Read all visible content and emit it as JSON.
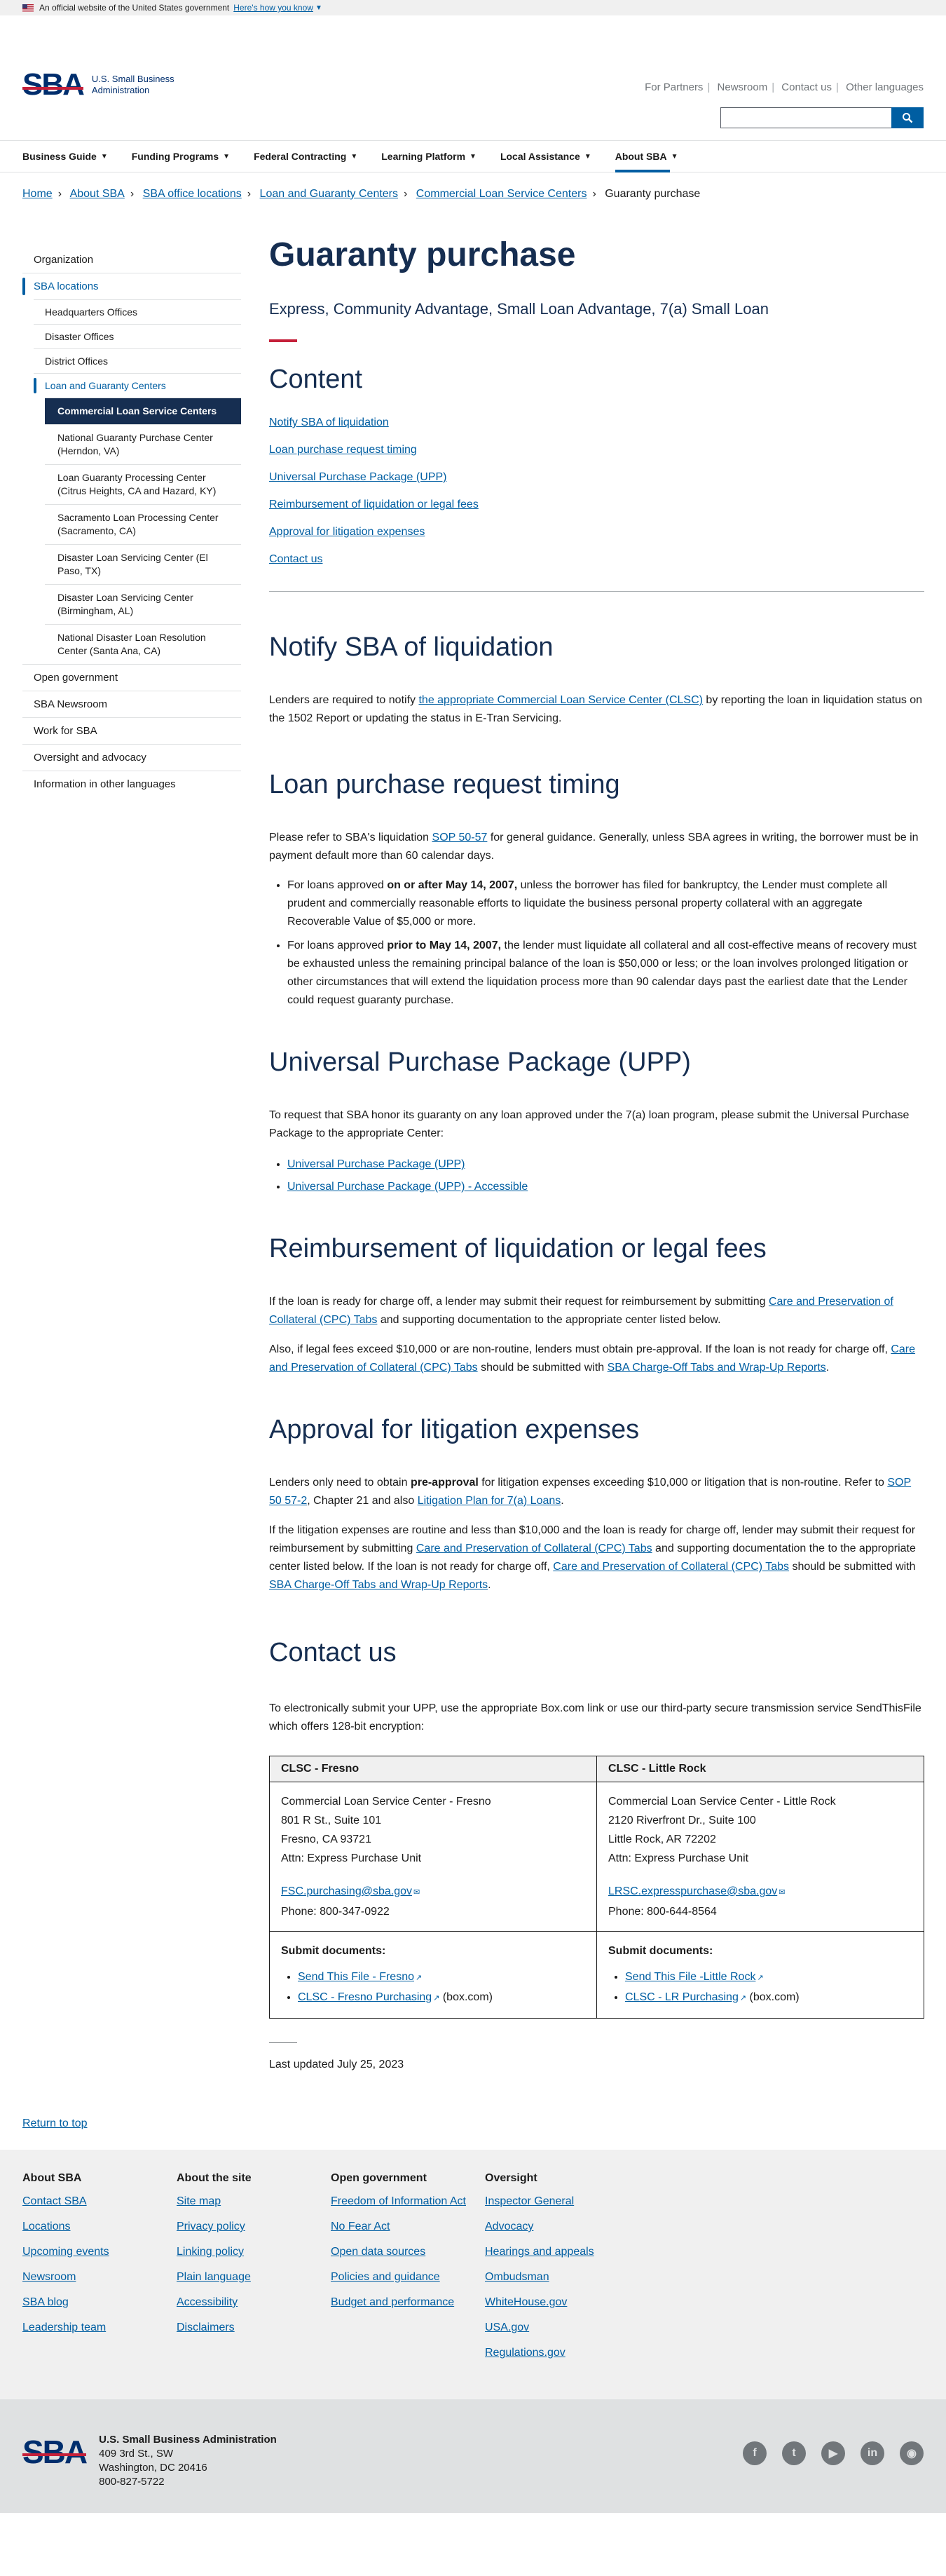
{
  "gov_banner": {
    "text": "An official website of the United States government",
    "link": "Here's how you know"
  },
  "header": {
    "logo_mark": "SBA",
    "logo_line1": "U.S. Small Business",
    "logo_line2": "Administration",
    "util_links": [
      "For Partners",
      "Newsroom",
      "Contact us",
      "Other languages"
    ],
    "search_placeholder": ""
  },
  "nav": [
    "Business Guide",
    "Funding Programs",
    "Federal Contracting",
    "Learning Platform",
    "Local Assistance",
    "About SBA"
  ],
  "breadcrumb": [
    "Home",
    "About SBA",
    "SBA office locations",
    "Loan and Guaranty Centers",
    "Commercial Loan Service Centers",
    "Guaranty purchase"
  ],
  "sidebar": {
    "items": [
      "Organization",
      "SBA locations"
    ],
    "sub": [
      "Headquarters Offices",
      "Disaster Offices",
      "District Offices",
      "Loan and Guaranty Centers"
    ],
    "sub2": [
      "Commercial Loan Service Centers",
      "National Guaranty Purchase Center (Herndon, VA)",
      "Loan Guaranty Processing Center (Citrus Heights, CA and Hazard, KY)",
      "Sacramento Loan Processing Center (Sacramento, CA)",
      "Disaster Loan Servicing Center (El Paso, TX)",
      "Disaster Loan Servicing Center (Birmingham, AL)",
      "National Disaster Loan Resolution Center (Santa Ana, CA)"
    ],
    "after": [
      "Open government",
      "SBA Newsroom",
      "Work for SBA",
      "Oversight and advocacy",
      "Information in other languages"
    ]
  },
  "page": {
    "title": "Guaranty purchase",
    "subtitle": "Express, Community Advantage, Small Loan Advantage, 7(a) Small Loan",
    "toc_title": "Content",
    "toc": [
      "Notify SBA of liquidation",
      "Loan purchase request timing",
      "Universal Purchase Package (UPP)",
      "Reimbursement of liquidation or legal fees",
      "Approval for litigation expenses",
      "Contact us"
    ]
  },
  "s1": {
    "title": "Notify SBA of liquidation",
    "p1a": "Lenders are required to notify ",
    "p1link": "the appropriate Commercial Loan Service Center (CLSC)",
    "p1b": " by reporting the loan in liquidation status on the 1502 Report or updating the status in E-Tran Servicing."
  },
  "s2": {
    "title": "Loan purchase request timing",
    "p1a": "Please refer to SBA's liquidation ",
    "p1link": "SOP 50-57",
    "p1b": " for general guidance. Generally, unless SBA agrees in writing, the borrower must be in payment default more than 60 calendar days.",
    "b1a": "For loans approved ",
    "b1strong": "on or after May 14, 2007,",
    "b1b": " unless the borrower has filed for bankruptcy, the Lender must complete all prudent and commercially reasonable efforts to liquidate the business personal property collateral with an aggregate Recoverable Value of $5,000 or more.",
    "b2a": "For loans approved ",
    "b2strong": "prior to May 14, 2007,",
    "b2b": " the lender must liquidate all collateral and all cost-effective means of recovery must be exhausted unless the remaining principal balance of the loan is $50,000 or less; or the loan involves prolonged litigation or other circumstances that will extend the liquidation process more than 90 calendar days past the earliest date that the Lender could request guaranty purchase."
  },
  "s3": {
    "title": "Universal Purchase Package (UPP)",
    "p1": "To request that SBA honor its guaranty on any loan approved under the 7(a) loan program, please submit the Universal Purchase Package to the appropriate Center:",
    "links": [
      "Universal Purchase Package (UPP)",
      "Universal Purchase Package (UPP) - Accessible"
    ]
  },
  "s4": {
    "title": "Reimbursement of liquidation or legal fees",
    "p1a": "If the loan is ready for charge off, a lender may submit their request for reimbursement by submitting ",
    "p1link": "Care and Preservation of Collateral (CPC) Tabs",
    "p1b": " and supporting documentation to the appropriate center listed below.",
    "p2a": "Also, if legal fees exceed $10,000 or are non-routine, lenders must obtain pre-approval. If the loan is not ready for charge off, ",
    "p2link1": "Care and Preservation of Collateral (CPC) Tabs",
    "p2b": " should be submitted with ",
    "p2link2": "SBA Charge-Off Tabs and Wrap-Up Reports",
    "p2c": "."
  },
  "s5": {
    "title": "Approval for litigation expenses",
    "p1a": "Lenders only need to obtain ",
    "p1strong": "pre-approval",
    "p1b": " for litigation expenses exceeding $10,000 or litigation that is non-routine. Refer to ",
    "p1link1": "SOP 50 57-2",
    "p1c": ", Chapter 21 and also ",
    "p1link2": "Litigation Plan for 7(a) Loans",
    "p1d": ".",
    "p2a": "If the litigation expenses are routine and less than $10,000 and the loan is ready for charge off, lender may submit their request for reimbursement by submitting ",
    "p2link1": "Care and Preservation of Collateral (CPC) Tabs",
    "p2b": " and supporting documentation the to the appropriate center listed below. If the loan is not ready for charge off, ",
    "p2link2": "Care and Preservation of Collateral (CPC) Tabs",
    "p2c": " should be submitted with ",
    "p2link3": "SBA Charge-Off Tabs and Wrap-Up Reports",
    "p2d": "."
  },
  "s6": {
    "title": "Contact us",
    "p1": "To electronically submit your UPP, use the appropriate Box.com link or use our third-party secure transmission service SendThisFile which offers 128-bit encryption:",
    "fresno": {
      "header": "CLSC - Fresno",
      "name": "Commercial Loan Service Center - Fresno",
      "street": "801 R St., Suite 101",
      "city": "Fresno, CA 93721",
      "attn": "Attn: Express Purchase Unit",
      "email": "FSC.purchasing@sba.gov",
      "phone": "Phone: 800-347-0922",
      "submit": "Submit documents:",
      "link1": "Send This File - Fresno",
      "link2": "CLSC - Fresno Purchasing",
      "link2_suffix": " (box.com)"
    },
    "littlerock": {
      "header": "CLSC - Little Rock",
      "name": "Commercial Loan Service Center - Little Rock",
      "street": "2120 Riverfront Dr., Suite 100",
      "city": "Little Rock, AR 72202",
      "attn": "Attn: Express Purchase Unit",
      "email": "LRSC.expresspurchase@sba.gov",
      "phone": "Phone: 800-644-8564",
      "submit": "Submit documents:",
      "link1": "Send This File -Little Rock",
      "link2": "CLSC - LR Purchasing",
      "link2_suffix": " (box.com)"
    }
  },
  "updated": "Last updated July 25, 2023",
  "return_top": "Return to top",
  "footer": {
    "cols": [
      {
        "title": "About SBA",
        "links": [
          "Contact SBA",
          "Locations",
          "Upcoming events",
          "Newsroom",
          "SBA blog",
          "Leadership team"
        ]
      },
      {
        "title": "About the site",
        "links": [
          "Site map",
          "Privacy policy",
          "Linking policy",
          "Plain language",
          "Accessibility",
          "Disclaimers"
        ]
      },
      {
        "title": "Open government",
        "links": [
          "Freedom of Information Act",
          "No Fear Act",
          "Open data sources",
          "Policies and guidance",
          "Budget and performance"
        ]
      },
      {
        "title": "Oversight",
        "links": [
          "Inspector General",
          "Advocacy",
          "Hearings and appeals",
          "Ombudsman",
          "WhiteHouse.gov",
          "USA.gov",
          "Regulations.gov"
        ]
      }
    ],
    "org": "U.S. Small Business Administration",
    "addr1": "409 3rd St., SW",
    "addr2": "Washington, DC 20416",
    "phone": "800-827-5722",
    "social": [
      "facebook-icon",
      "twitter-icon",
      "youtube-icon",
      "linkedin-icon",
      "instagram-icon"
    ]
  },
  "colors": {
    "brand_navy": "#162e51",
    "link": "#005ea2",
    "accent_red": "#c5203a"
  }
}
